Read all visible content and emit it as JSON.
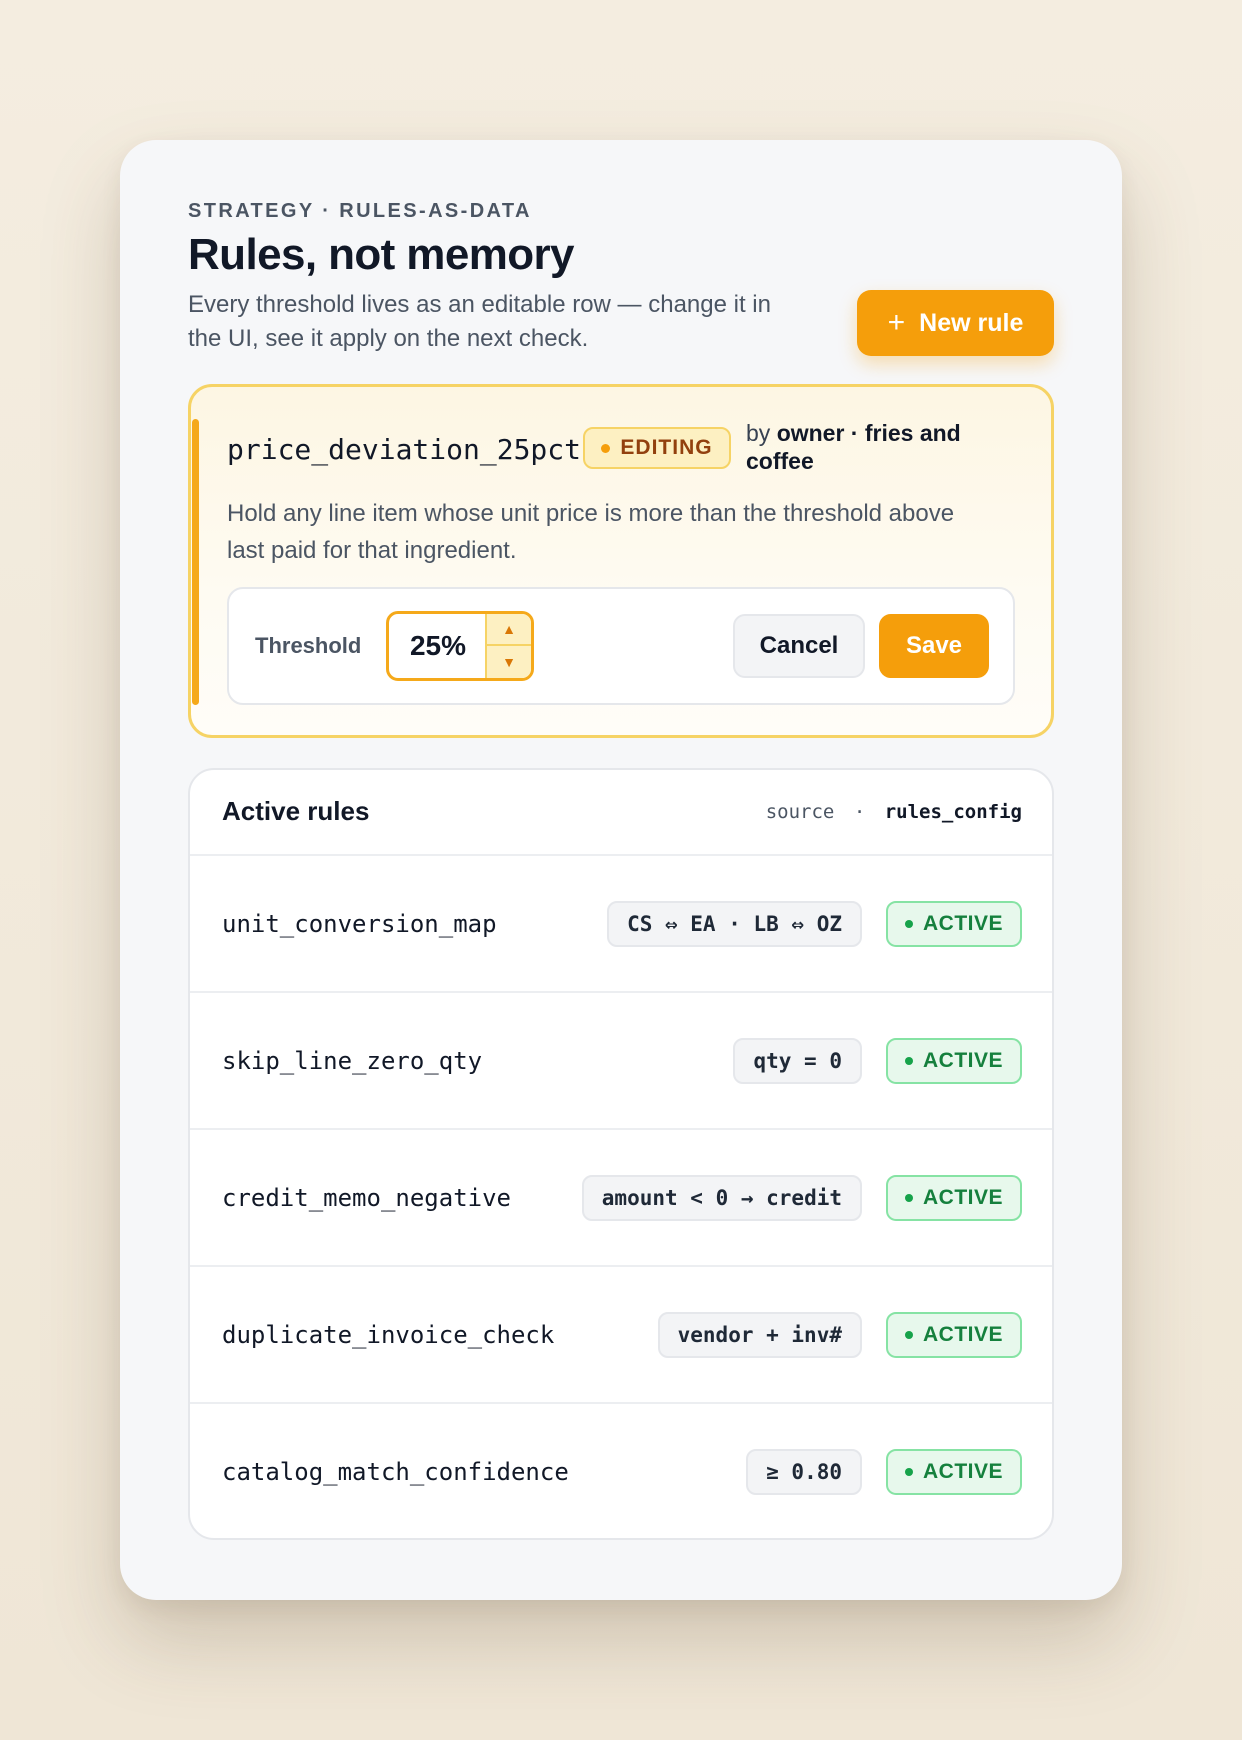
{
  "header": {
    "eyebrow": "STRATEGY · RULES-AS-DATA",
    "title": "Rules, not memory",
    "subtitle": "Every threshold lives as an editable row — change it in the UI, see it apply on the next check.",
    "new_rule_label": "New rule",
    "new_rule_icon": "plus-icon"
  },
  "editor": {
    "rule_name": "price_deviation_25pct",
    "badge": "EDITING",
    "by_prefix": "by",
    "by_owner": "owner · fries and coffee",
    "description": "Hold any line item whose unit price is more than the threshold above last paid for that ingredient.",
    "threshold_label": "Threshold",
    "threshold_value": "25%",
    "cancel_label": "Cancel",
    "save_label": "Save",
    "accent_color": "#f59e0b"
  },
  "rules": {
    "title": "Active rules",
    "source_label": "source",
    "source_sep": "·",
    "source_value": "rules_config",
    "items": [
      {
        "name": "unit_conversion_map",
        "chip": "CS ⇔ EA · LB ⇔ OZ",
        "status": "ACTIVE"
      },
      {
        "name": "skip_line_zero_qty",
        "chip": "qty = 0",
        "status": "ACTIVE"
      },
      {
        "name": "credit_memo_negative",
        "chip": "amount < 0 → credit",
        "status": "ACTIVE"
      },
      {
        "name": "duplicate_invoice_check",
        "chip": "vendor + inv#",
        "status": "ACTIVE"
      },
      {
        "name": "catalog_match_confidence",
        "chip": "≥ 0.80",
        "status": "ACTIVE"
      }
    ],
    "status_color": "#16a34a"
  }
}
